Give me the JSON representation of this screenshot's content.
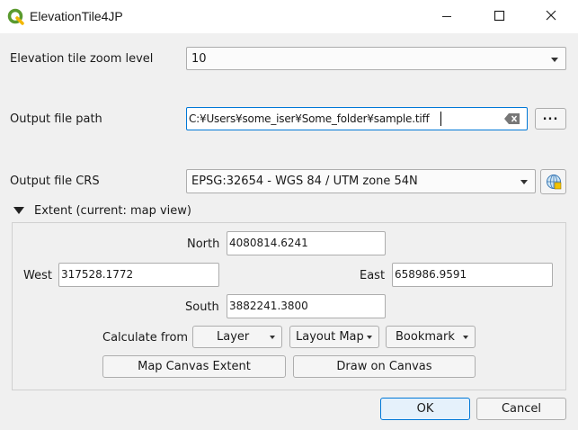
{
  "window": {
    "title": "ElevationTile4JP"
  },
  "icons": {
    "app": "qgis-logo-icon",
    "minimize": "minimize-icon",
    "maximize": "maximize-icon",
    "close": "close-icon",
    "clear": "clear-icon",
    "crs": "crs-globe-icon",
    "extent_toggle": "triangle-down-icon"
  },
  "colors": {
    "focus_border": "#0078d7",
    "qgis_green": "#5a9a2f"
  },
  "zoom": {
    "label": "Elevation tile zoom level",
    "value": "10"
  },
  "output_path": {
    "label": "Output file path",
    "value": "C:¥Users¥some_iser¥Some_folder¥sample.tiff",
    "browse_label": "..."
  },
  "crs": {
    "label": "Output file CRS",
    "value": "EPSG:32654 - WGS 84 / UTM zone 54N"
  },
  "extent": {
    "header": "Extent (current: map view)",
    "north_label": "North",
    "north_value": "4080814.6241",
    "west_label": "West",
    "west_value": "317528.1772",
    "east_label": "East",
    "east_value": "658986.9591",
    "south_label": "South",
    "south_value": "3882241.3800",
    "calculate_from_label": "Calculate from",
    "layer_label": "Layer",
    "layout_map_label": "Layout Map",
    "bookmark_label": "Bookmark",
    "map_canvas_extent_label": "Map Canvas Extent",
    "draw_on_canvas_label": "Draw on Canvas"
  },
  "footer": {
    "ok_label": "OK",
    "cancel_label": "Cancel"
  }
}
